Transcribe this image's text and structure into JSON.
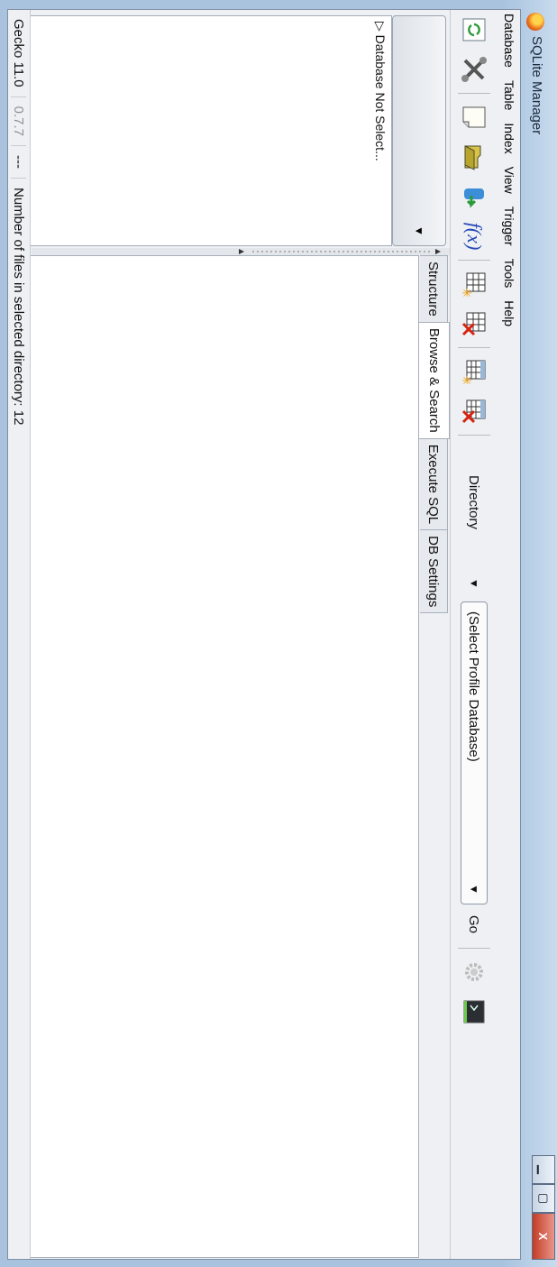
{
  "window": {
    "title": "SQLite Manager",
    "minimize_glyph": "▁",
    "maximize_glyph": "▢",
    "close_glyph": "X"
  },
  "menu": [
    "Database",
    "Table",
    "Index",
    "View",
    "Trigger",
    "Tools",
    "Help"
  ],
  "toolbar": {
    "directory_label": "Directory",
    "directory_arrow": "▼",
    "profile_select": "(Select Profile Database)",
    "profile_arrow": "▼",
    "go_label": "Go",
    "function_label": "f(x)"
  },
  "sidebar": {
    "dropdown_arrow": "▼",
    "tree_item": "▷ Database Not Select..."
  },
  "tabs": [
    "Structure",
    "Browse & Search",
    "Execute SQL",
    "DB Settings"
  ],
  "active_tab": "Browse & Search",
  "status": {
    "engine": "Gecko 11.0",
    "version": "0.7.7",
    "dashes": "---",
    "message": "Number of files in selected directory: 12"
  }
}
